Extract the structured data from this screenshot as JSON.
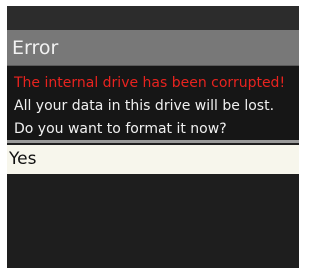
{
  "dialog": {
    "title": "Error",
    "error_message": "The internal drive has been corrupted!",
    "info_line_1": "All your data in this drive will be lost.",
    "info_line_2": "Do you want to format it now?"
  },
  "options": {
    "selected_label": "Yes"
  },
  "colors": {
    "screen_background": "#1f1f1f",
    "title_bar": "#787878",
    "error_text": "#e8231f",
    "selection_highlight": "#f7f6ec"
  }
}
